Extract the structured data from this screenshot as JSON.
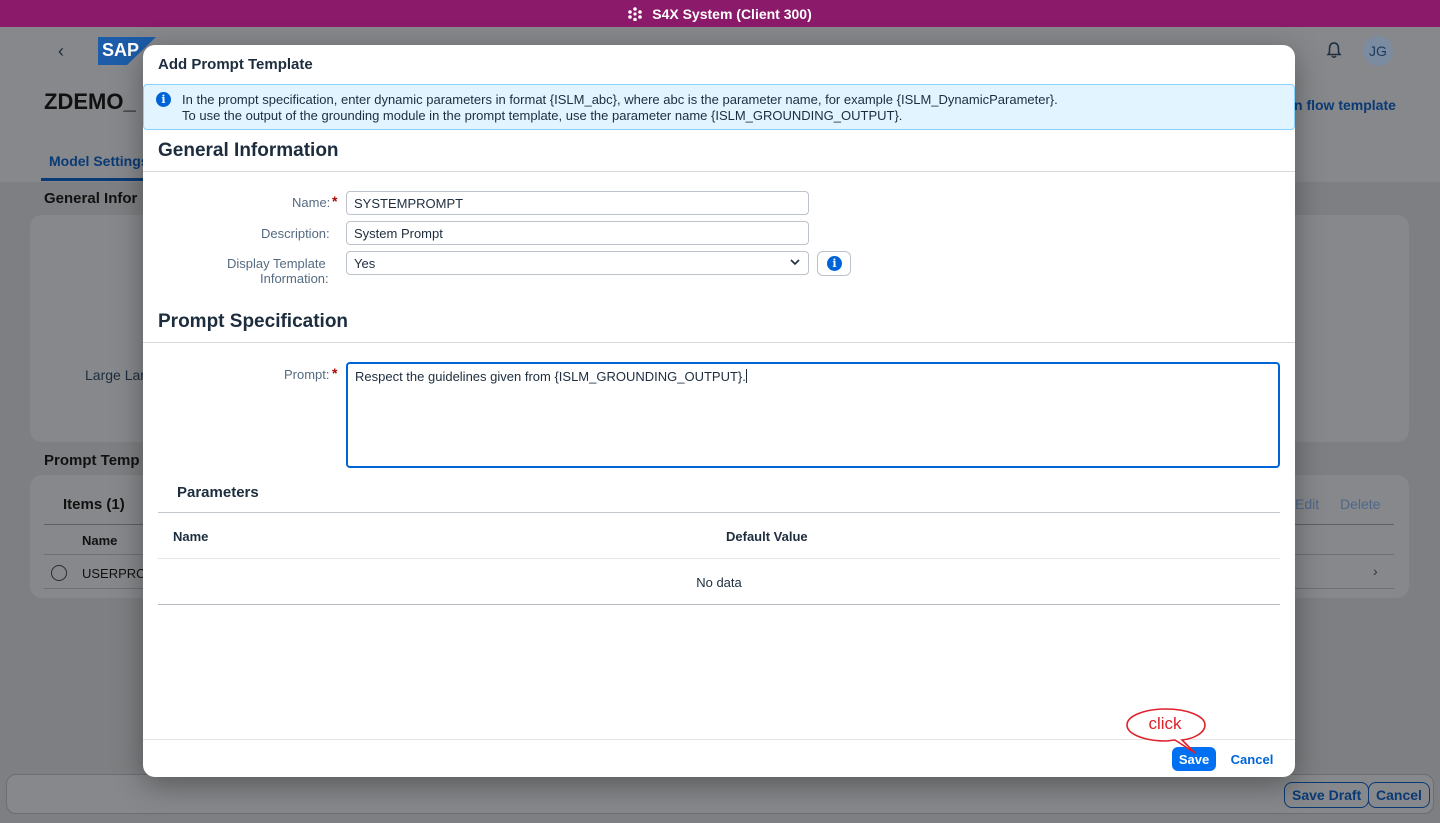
{
  "shell": {
    "system_title": "S4X System (Client 300)"
  },
  "background": {
    "logo": "SAP",
    "page_title": "ZDEMO_",
    "tab_label": "Model Settings",
    "avatar_initials": "JG",
    "header_link": "n flow template",
    "section_general": "General Infor",
    "field_label": "Large Lan",
    "section_prompts": "Prompt Temp",
    "items_title": "Items (1)",
    "col_name": "Name",
    "row_value": "USERPRO",
    "edit_label": "Edit",
    "delete_label": "Delete",
    "save_draft_label": "Save Draft",
    "cancel_label": "Cancel"
  },
  "dialog": {
    "title": "Add Prompt Template",
    "info_line1": "In the prompt specification, enter dynamic parameters in format {ISLM_abc}, where abc is the parameter name, for example {ISLM_DynamicParameter}.",
    "info_line2": "To use the output of the grounding module in the prompt template, use the parameter name {ISLM_GROUNDING_OUTPUT}.",
    "general_section": "General Information",
    "name_label": "Name:",
    "name_value": "SYSTEMPROMPT",
    "description_label": "Description:",
    "description_value": "System Prompt",
    "display_label_line1": "Display Template",
    "display_label_line2": "Information:",
    "display_value": "Yes",
    "prompt_section": "Prompt Specification",
    "prompt_label": "Prompt:",
    "prompt_value": "Respect the guidelines given from {ISLM_GROUNDING_OUTPUT}.",
    "parameters_title": "Parameters",
    "col_name": "Name",
    "col_default": "Default Value",
    "no_data": "No data",
    "save_label": "Save",
    "cancel_label": "Cancel"
  },
  "annotation": {
    "text": "click",
    "color": "#e0202a"
  },
  "colors": {
    "shell": "#8c1a6a",
    "brand_blue": "#0070f2",
    "info_bg": "#e1f4ff",
    "required": "#aa0808"
  }
}
